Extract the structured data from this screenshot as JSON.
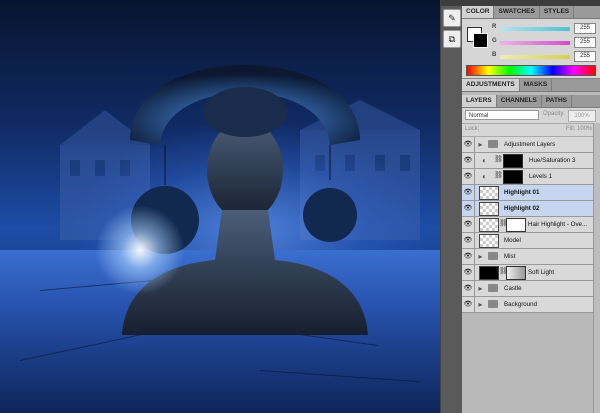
{
  "color_panel": {
    "tabs": [
      "COLOR",
      "SWATCHES",
      "STYLES"
    ],
    "active_tab": "COLOR",
    "foreground": "#ffffff",
    "background": "#000000",
    "channels": [
      {
        "label": "R",
        "value": "255",
        "gradient": "#4ec0d8"
      },
      {
        "label": "G",
        "value": "255",
        "gradient": "#d24ccc"
      },
      {
        "label": "B",
        "value": "255",
        "gradient": "#d8d24a"
      }
    ]
  },
  "adjustments_panel": {
    "tabs": [
      "ADJUSTMENTS",
      "MASKS"
    ]
  },
  "layers_panel": {
    "tabs": [
      "LAYERS",
      "CHANNELS",
      "PATHS"
    ],
    "blend_mode": "Normal",
    "opacity_label": "Opacity:",
    "opacity_value": "100%",
    "lock_label": "Lock:",
    "fill_label": "Fill:",
    "fill_value": "100%",
    "layers": [
      {
        "name": "Adjustment Layers",
        "kind": "group",
        "bold": false,
        "selected": false
      },
      {
        "name": "Hue/Saturation 3",
        "kind": "adjustment",
        "bold": false,
        "selected": false
      },
      {
        "name": "Levels 1",
        "kind": "adjustment",
        "bold": false,
        "selected": false
      },
      {
        "name": "Highlight 01",
        "kind": "pixel",
        "bold": true,
        "selected": true
      },
      {
        "name": "Highlight 02",
        "kind": "pixel",
        "bold": true,
        "selected": true
      },
      {
        "name": "Hair Highlight - Ove...",
        "kind": "masked",
        "bold": false,
        "selected": false
      },
      {
        "name": "Model",
        "kind": "pixel-model",
        "bold": false,
        "selected": false
      },
      {
        "name": "Mist",
        "kind": "group",
        "bold": false,
        "selected": false
      },
      {
        "name": "Soft Light",
        "kind": "masked-dark",
        "bold": false,
        "selected": false
      },
      {
        "name": "Castle",
        "kind": "group",
        "bold": false,
        "selected": false
      },
      {
        "name": "Background",
        "kind": "group",
        "bold": false,
        "selected": false
      }
    ]
  },
  "icons": {
    "tool_1": "color-picker-icon",
    "tool_2": "history-icon",
    "visibility": "eye-icon",
    "group": "folder-icon",
    "link": "chain-link-icon"
  }
}
